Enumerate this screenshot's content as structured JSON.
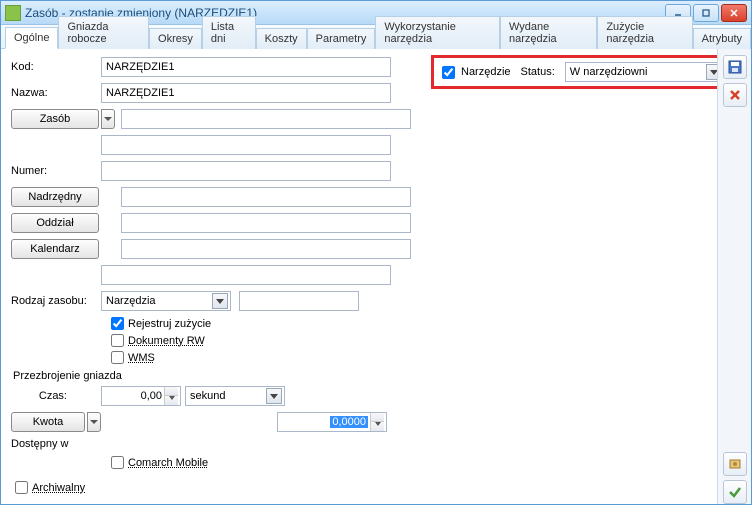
{
  "window": {
    "title": "Zasób - zostanie zmieniony  (NARZĘDZIE1)"
  },
  "tabs": [
    "Ogólne",
    "Gniazda robocze",
    "Okresy",
    "Lista dni",
    "Koszty",
    "Parametry",
    "Wykorzystanie narzędzia",
    "Wydane narzędzia",
    "Zużycie narzędzia",
    "Atrybuty"
  ],
  "labels": {
    "kod": "Kod:",
    "nazwa": "Nazwa:",
    "zasob": "Zasób",
    "numer": "Numer:",
    "nadrzedny": "Nadrzędny",
    "oddzial": "Oddział",
    "kalendarz": "Kalendarz",
    "rodzaj": "Rodzaj zasobu:",
    "rejestruj": "Rejestruj zużycie",
    "dokrw": "Dokumenty RW",
    "wms": "WMS",
    "przezbrojenie": "Przezbrojenie gniazda",
    "czas": "Czas:",
    "sekund": "sekund",
    "kwota": "Kwota",
    "dostepny": "Dostępny w",
    "comarch": "Comarch Mobile",
    "archiwalny": "Archiwalny",
    "narzedzie": "Narzędzie",
    "status": "Status:"
  },
  "fields": {
    "kod_value": "NARZĘDZIE1",
    "nazwa_value": "NARZĘDZIE1",
    "zasob_value": "",
    "zasob_extra": "",
    "numer_value": "",
    "nadrzedny_value": "",
    "oddzial_value": "",
    "kalendarz_value": "",
    "kalendarz_extra": "",
    "rodzaj_value": "Narzędzia",
    "rodzaj_extra": "",
    "czas_value": "0,00",
    "kwota_value": "0,0000",
    "status_value": "W narzędziowni"
  },
  "checks": {
    "rejestruj": true,
    "dokrw": false,
    "wms": false,
    "comarch": false,
    "archiwalny": false,
    "narzedzie": true
  },
  "icons": {
    "save": "save-icon",
    "delete": "delete-icon",
    "settings": "settings-icon",
    "check": "check-icon"
  }
}
